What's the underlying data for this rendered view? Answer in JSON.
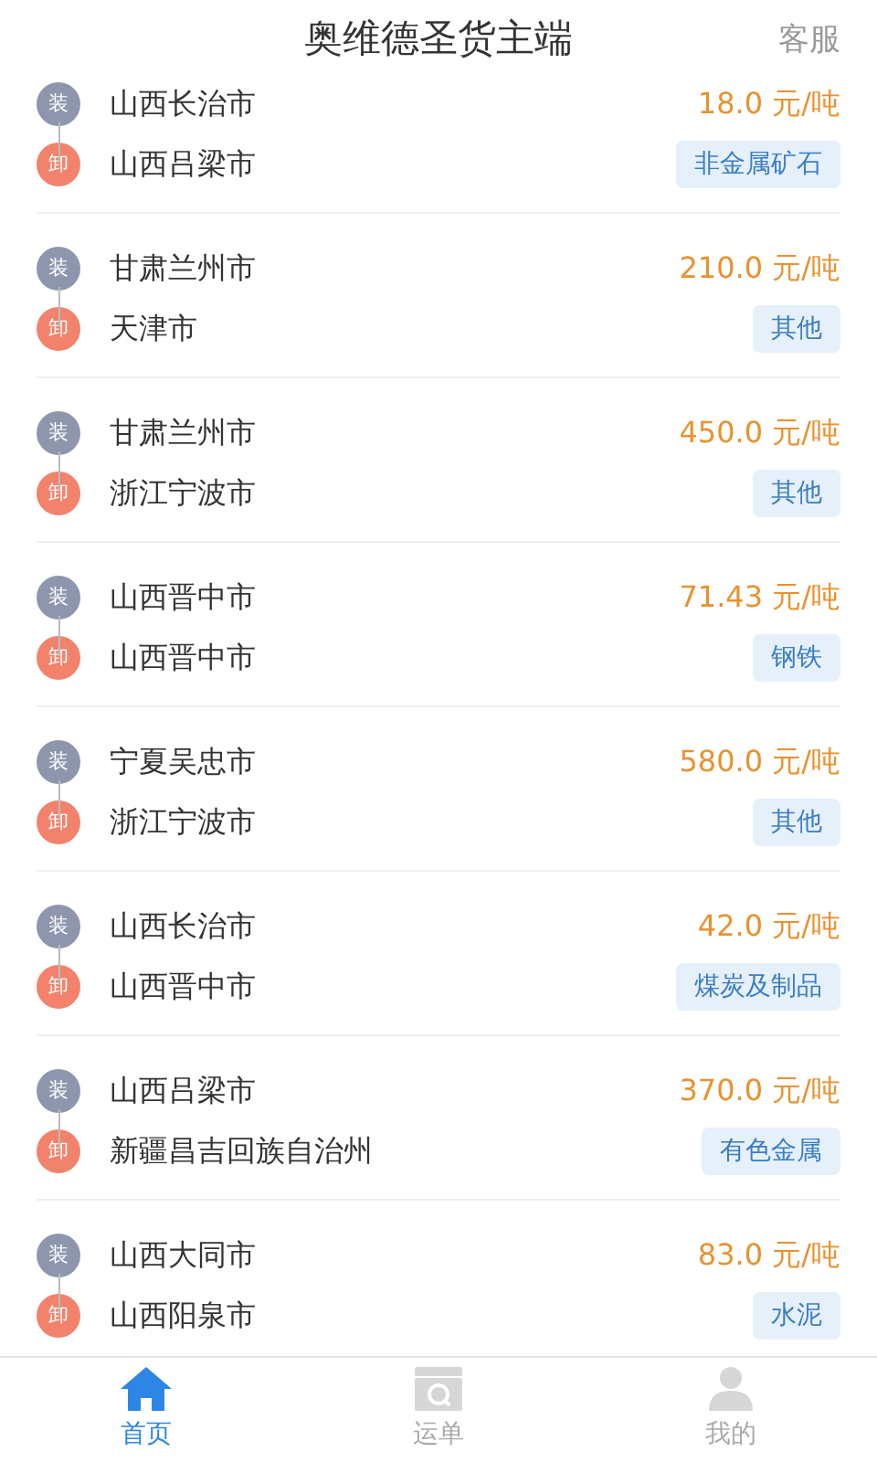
{
  "header": {
    "title": "奥维德圣货主端",
    "action": "客服"
  },
  "orders": [
    {
      "load_badge": "装",
      "load": "山西长治市",
      "unload_badge": "卸",
      "unload": "山西吕梁市",
      "price": "18.0 元/吨",
      "category": "非金属矿石"
    },
    {
      "load_badge": "装",
      "load": "甘肃兰州市",
      "unload_badge": "卸",
      "unload": "天津市",
      "price": "210.0 元/吨",
      "category": "其他"
    },
    {
      "load_badge": "装",
      "load": "甘肃兰州市",
      "unload_badge": "卸",
      "unload": "浙江宁波市",
      "price": "450.0 元/吨",
      "category": "其他"
    },
    {
      "load_badge": "装",
      "load": "山西晋中市",
      "unload_badge": "卸",
      "unload": "山西晋中市",
      "price": "71.43 元/吨",
      "category": "钢铁"
    },
    {
      "load_badge": "装",
      "load": "宁夏吴忠市",
      "unload_badge": "卸",
      "unload": "浙江宁波市",
      "price": "580.0 元/吨",
      "category": "其他"
    },
    {
      "load_badge": "装",
      "load": "山西长治市",
      "unload_badge": "卸",
      "unload": "山西晋中市",
      "price": "42.0 元/吨",
      "category": "煤炭及制品"
    },
    {
      "load_badge": "装",
      "load": "山西吕梁市",
      "unload_badge": "卸",
      "unload": "新疆昌吉回族自治州",
      "price": "370.0 元/吨",
      "category": "有色金属"
    },
    {
      "load_badge": "装",
      "load": "山西大同市",
      "unload_badge": "卸",
      "unload": "山西阳泉市",
      "price": "83.0 元/吨",
      "category": "水泥"
    }
  ],
  "tabs": [
    {
      "kind": "home",
      "label": "首页",
      "selected": true
    },
    {
      "kind": "waybill",
      "label": "运单",
      "selected": false
    },
    {
      "kind": "profile",
      "label": "我的",
      "selected": false
    }
  ]
}
